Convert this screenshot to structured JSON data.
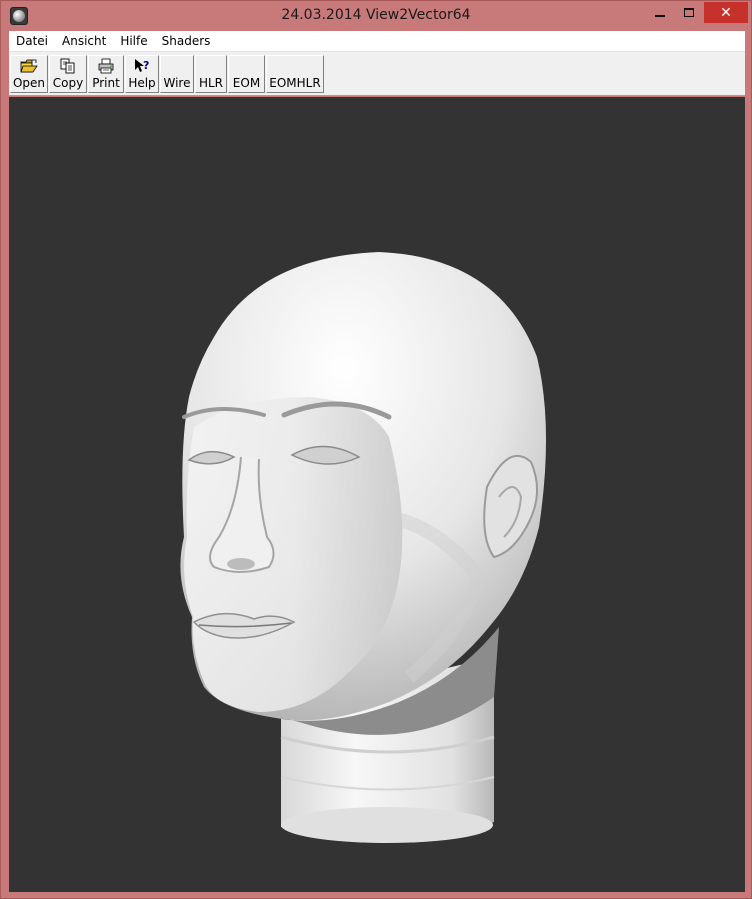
{
  "window": {
    "title": "24.03.2014 View2Vector64",
    "app_icon": "app-sphere-icon",
    "controls": {
      "minimize": "minimize-icon",
      "maximize": "maximize-icon",
      "close": "✕"
    }
  },
  "menu": {
    "items": [
      {
        "label": "Datei"
      },
      {
        "label": "Ansicht"
      },
      {
        "label": "Hilfe"
      },
      {
        "label": "Shaders"
      }
    ]
  },
  "toolbar": {
    "buttons": [
      {
        "label": "Open",
        "icon": "folder-open-icon"
      },
      {
        "label": "Copy",
        "icon": "copy-icon"
      },
      {
        "label": "Print",
        "icon": "printer-icon"
      },
      {
        "label": "Help",
        "icon": "help-pointer-icon"
      },
      {
        "label": "Wire"
      },
      {
        "label": "HLR"
      },
      {
        "label": "EOM"
      },
      {
        "label": "EOMHLR"
      }
    ]
  },
  "viewport": {
    "background": "#333333",
    "model": "shaded-head-model"
  },
  "colors": {
    "frame": "#c87a7a",
    "close_button": "#c7312c",
    "toolbar_bg": "#f0f0f0",
    "model_light": "#f2f2f2",
    "model_shadow": "#8c8c8c"
  }
}
